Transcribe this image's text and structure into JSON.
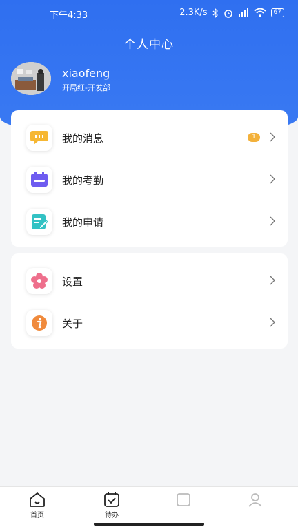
{
  "status_bar": {
    "time": "下午4:33",
    "speed": "2.3K/s",
    "battery": "67"
  },
  "header": {
    "title": "个人中心"
  },
  "profile": {
    "username": "xiaofeng",
    "department": "开局红-开发部"
  },
  "menu_group1": [
    {
      "label": "我的消息",
      "icon": "message-icon",
      "badge": "1"
    },
    {
      "label": "我的考勤",
      "icon": "calendar-icon"
    },
    {
      "label": "我的申请",
      "icon": "edit-document-icon"
    }
  ],
  "menu_group2": [
    {
      "label": "设置",
      "icon": "flower-settings-icon"
    },
    {
      "label": "关于",
      "icon": "info-icon"
    }
  ],
  "tabbar": [
    {
      "label": "首页",
      "icon": "home-icon"
    },
    {
      "label": "待办",
      "icon": "todo-calendar-icon"
    },
    {
      "label": "",
      "icon": "tab-icon"
    },
    {
      "label": "",
      "icon": "tab-icon"
    }
  ],
  "colors": {
    "primary": "#2f6ff0",
    "badge": "#f3b13b",
    "background": "#f4f5f7"
  }
}
